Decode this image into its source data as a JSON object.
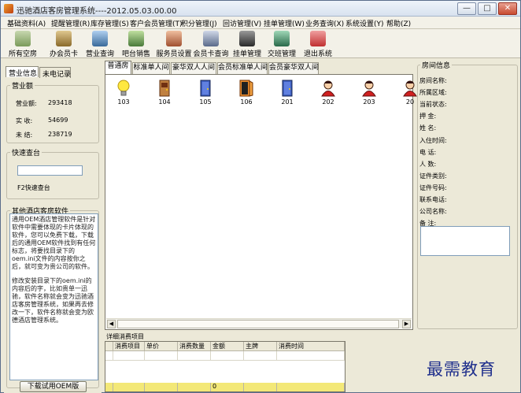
{
  "window": {
    "title": "迅驰酒店客房管理系统----2012.05.03.00.00",
    "minimize": "—",
    "maximize": "□",
    "close": "✕"
  },
  "menu": [
    "基础资料(A)",
    "提醒管理(R)",
    "库存管理(S)",
    "客户会员管理(T)",
    "积分管理(J)",
    "回访管理(V)",
    "挂单管理(W)",
    "业务查询(X)",
    "系统设置(Y)",
    "帮助(Z)"
  ],
  "toolbar": [
    {
      "label": "所有空房",
      "icon": "bed-icon",
      "color": "#7a9a5a"
    },
    {
      "label": "办会员卡",
      "icon": "member-card-icon",
      "color": "#8a6a2a"
    },
    {
      "label": "营业查询",
      "icon": "business-query-icon",
      "color": "#3a6a9a"
    },
    {
      "label": "吧台销售",
      "icon": "bar-sales-icon",
      "color": "#4a7a3a"
    },
    {
      "label": "服务员设置",
      "icon": "waiter-settings-icon",
      "color": "#a05030"
    },
    {
      "label": "会员卡查询",
      "icon": "card-query-icon",
      "color": "#5a6a8a"
    },
    {
      "label": "挂单管理",
      "icon": "pending-order-icon",
      "color": "#3a3a3a"
    },
    {
      "label": "交班管理",
      "icon": "shift-handover-icon",
      "color": "#2a6a4a"
    },
    {
      "label": "退出系统",
      "icon": "exit-icon",
      "color": "#c03030"
    }
  ],
  "left": {
    "tabs": [
      "营业信息",
      "未电记录"
    ],
    "revenue": {
      "title": "营业额",
      "rows": [
        {
          "label": "营业额:",
          "value": "293418"
        },
        {
          "label": "实  收:",
          "value": "54699"
        },
        {
          "label": "未  结:",
          "value": "238719"
        }
      ]
    },
    "quick": {
      "title": "快速查台",
      "input_value": "",
      "hint": "F2快速查台"
    },
    "other": {
      "title": "其他酒店客房软件",
      "text_a": "通用OEM酒店管理软件是针对软件中需要体现的卡片体现的软件，您可以免费下载，下载后的通用OEM软件找到有任何标志，将要找目录下的oem.ini文件的内容按你之后，就可变为贵公司的软件。",
      "text_b": "修改安装目录下的oem.ini的内容后的字，比如贵单一迅驰，软件名称就会变为迅驰酒店客房管理系统，如果再去修改一下，软件名称就会变为欧德酒店管理系统。",
      "download": "下载试用OEM版"
    }
  },
  "room_tabs": [
    "普通房",
    "标准单人间",
    "豪华双人人间",
    "会员标准单人间",
    "会员豪华双人间"
  ],
  "active_room_tab": 0,
  "rooms": [
    {
      "number": "103",
      "icon": "lightbulb-icon",
      "status": "bulb"
    },
    {
      "number": "104",
      "icon": "door-occupied-icon",
      "status": "door-brown"
    },
    {
      "number": "105",
      "icon": "door-vacant-icon",
      "status": "door-blue"
    },
    {
      "number": "106",
      "icon": "door-open-icon",
      "status": "door-orange"
    },
    {
      "number": "201",
      "icon": "door-vacant-icon",
      "status": "door-blue"
    },
    {
      "number": "202",
      "icon": "guest-icon",
      "status": "guest"
    },
    {
      "number": "203",
      "icon": "guest-icon",
      "status": "guest"
    },
    {
      "number": "20",
      "icon": "guest-icon",
      "status": "guest"
    }
  ],
  "room_info": {
    "title": "房间信息",
    "fields": [
      "房间名称:",
      "所属区域:",
      "当前状态:",
      "押    金:",
      "姓    名:",
      "入住时间:",
      "电    话:",
      "人    数:",
      "证件类别:",
      "证件号码:",
      "联系电话:",
      "公司名称:",
      "备    注:"
    ]
  },
  "details": {
    "title": "详细消费项目",
    "columns": [
      "消费项目",
      "单价",
      "消费数量",
      "金额",
      "主牌",
      "消费时间"
    ],
    "total_amount": "0"
  },
  "watermark": "最需教育"
}
